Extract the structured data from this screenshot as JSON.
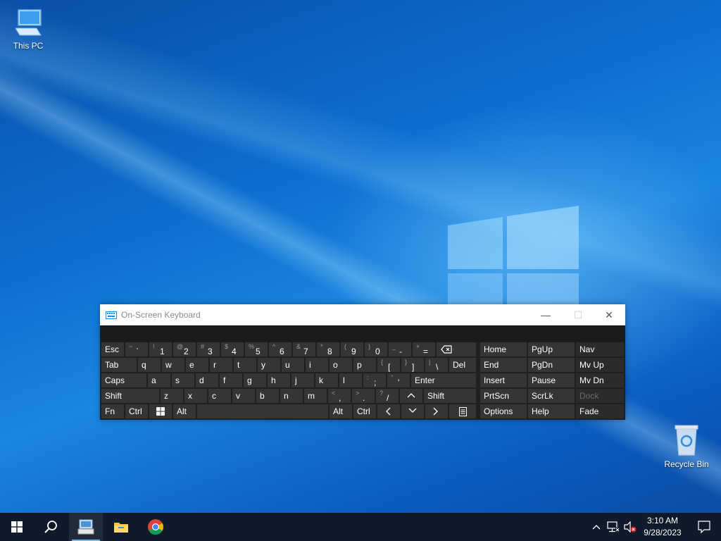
{
  "desktop": {
    "icons": [
      {
        "label": "This PC",
        "icon": "this-pc-icon"
      },
      {
        "label": "Recycle Bin",
        "icon": "recycle-bin-icon"
      }
    ]
  },
  "osk": {
    "title": "On-Screen Keyboard",
    "controls": {
      "minimize": "—",
      "maximize": "☐",
      "close": "✕"
    },
    "keys": {
      "esc": "Esc",
      "tab": "Tab",
      "caps": "Caps",
      "shift": "Shift",
      "fn": "Fn",
      "ctrl": "Ctrl",
      "alt": "Alt",
      "del": "Del",
      "enter": "Enter",
      "home": "Home",
      "pgup": "PgUp",
      "nav": "Nav",
      "end": "End",
      "pgdn": "PgDn",
      "mvup": "Mv Up",
      "insert": "Insert",
      "pause": "Pause",
      "mvdn": "Mv Dn",
      "prtscn": "PrtScn",
      "scrlk": "ScrLk",
      "dock": "Dock",
      "options": "Options",
      "help": "Help",
      "fade": "Fade",
      "row1": [
        {
          "sh": "~",
          "mn": "`"
        },
        {
          "sh": "!",
          "mn": "1"
        },
        {
          "sh": "@",
          "mn": "2"
        },
        {
          "sh": "#",
          "mn": "3"
        },
        {
          "sh": "$",
          "mn": "4"
        },
        {
          "sh": "%",
          "mn": "5"
        },
        {
          "sh": "^",
          "mn": "6"
        },
        {
          "sh": "&",
          "mn": "7"
        },
        {
          "sh": "*",
          "mn": "8"
        },
        {
          "sh": "(",
          "mn": "9"
        },
        {
          "sh": ")",
          "mn": "0"
        },
        {
          "sh": "_",
          "mn": "-"
        },
        {
          "sh": "+",
          "mn": "="
        }
      ],
      "row2": [
        "q",
        "w",
        "e",
        "r",
        "t",
        "y",
        "u",
        "i",
        "o",
        "p"
      ],
      "row2_brackets": [
        {
          "sh": "{",
          "mn": "["
        },
        {
          "sh": "}",
          "mn": "]"
        },
        {
          "sh": "|",
          "mn": "\\"
        }
      ],
      "row3": [
        "a",
        "s",
        "d",
        "f",
        "g",
        "h",
        "j",
        "k",
        "l"
      ],
      "row3_punct": [
        {
          "sh": ":",
          "mn": ";"
        },
        {
          "sh": "\"",
          "mn": "'"
        }
      ],
      "row4": [
        "z",
        "x",
        "c",
        "v",
        "b",
        "n",
        "m"
      ],
      "row4_punct": [
        {
          "sh": "<",
          "mn": ","
        },
        {
          "sh": ">",
          "mn": "."
        },
        {
          "sh": "?",
          "mn": "/"
        }
      ]
    }
  },
  "taskbar": {
    "items": [
      "start-icon",
      "search-icon",
      "osk-app-icon",
      "file-explorer-icon",
      "chrome-icon"
    ],
    "clock_time": "3:10 AM",
    "clock_date": "9/28/2023"
  },
  "colors": {
    "accent": "#0078d7",
    "taskbar": "#101a2a",
    "osk_key": "#353535"
  }
}
